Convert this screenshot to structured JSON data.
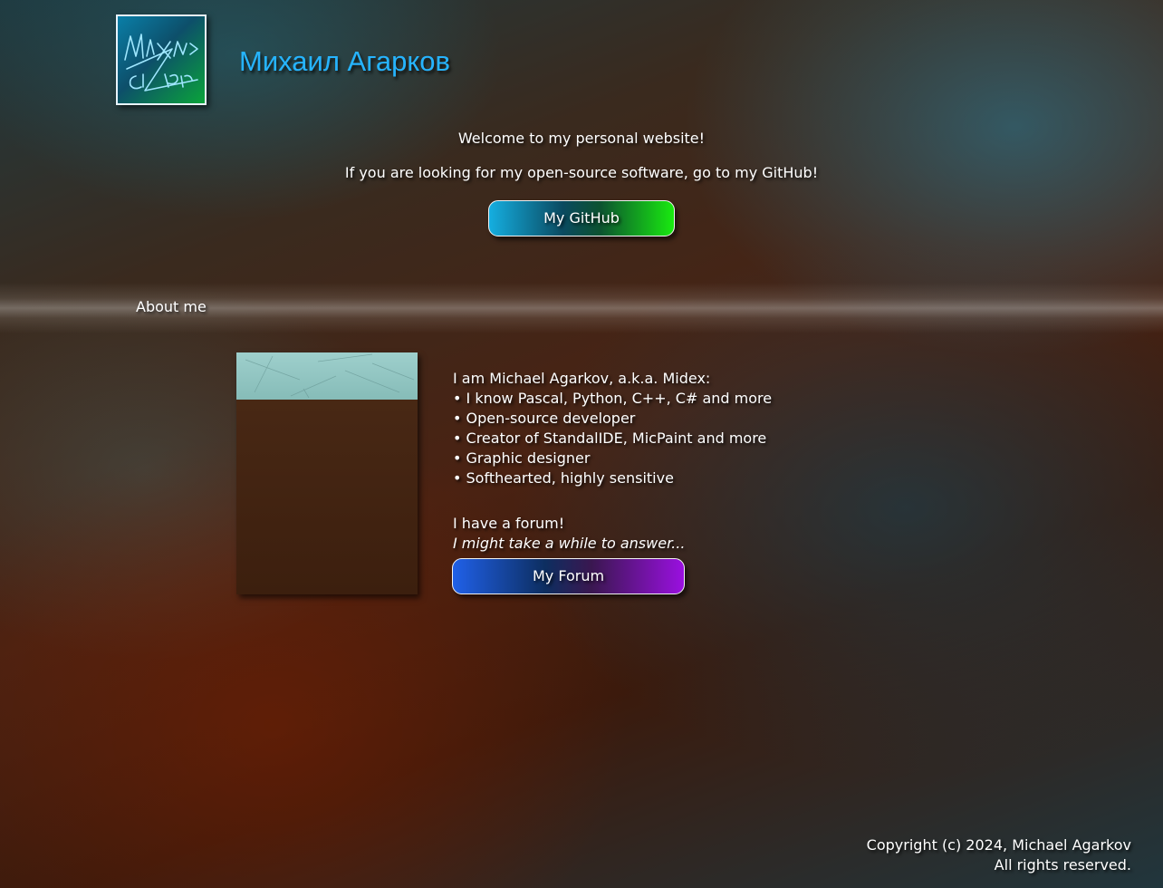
{
  "header": {
    "title": "Михаил Агарков",
    "logo_icon": "signature-logo-icon"
  },
  "welcome": {
    "line1": "Welcome to my personal website!",
    "line2": "If you are looking for my open-source software, go to my GitHub!",
    "github_button": "My GitHub"
  },
  "about": {
    "heading": "About me",
    "intro": "I am Michael Agarkov, a.k.a. Midex:",
    "items": [
      "• I know Pascal, Python, C++, C# and more",
      "• Open-source developer",
      "• Creator of StandalIDE, MicPaint and more",
      "• Graphic designer",
      "• Softhearted, highly sensitive"
    ],
    "forum_line": "I have a forum!",
    "forum_note": "I might take a while to answer...",
    "forum_button": "My Forum"
  },
  "footer": {
    "copyright": "Copyright (c) 2024, Michael Agarkov",
    "rights": "All rights reserved."
  },
  "colors": {
    "title": "#26b4ff",
    "github_gradient_start": "#15aee0",
    "github_gradient_end": "#19ea10",
    "forum_gradient_start": "#2060e8",
    "forum_gradient_end": "#9a10e0"
  }
}
